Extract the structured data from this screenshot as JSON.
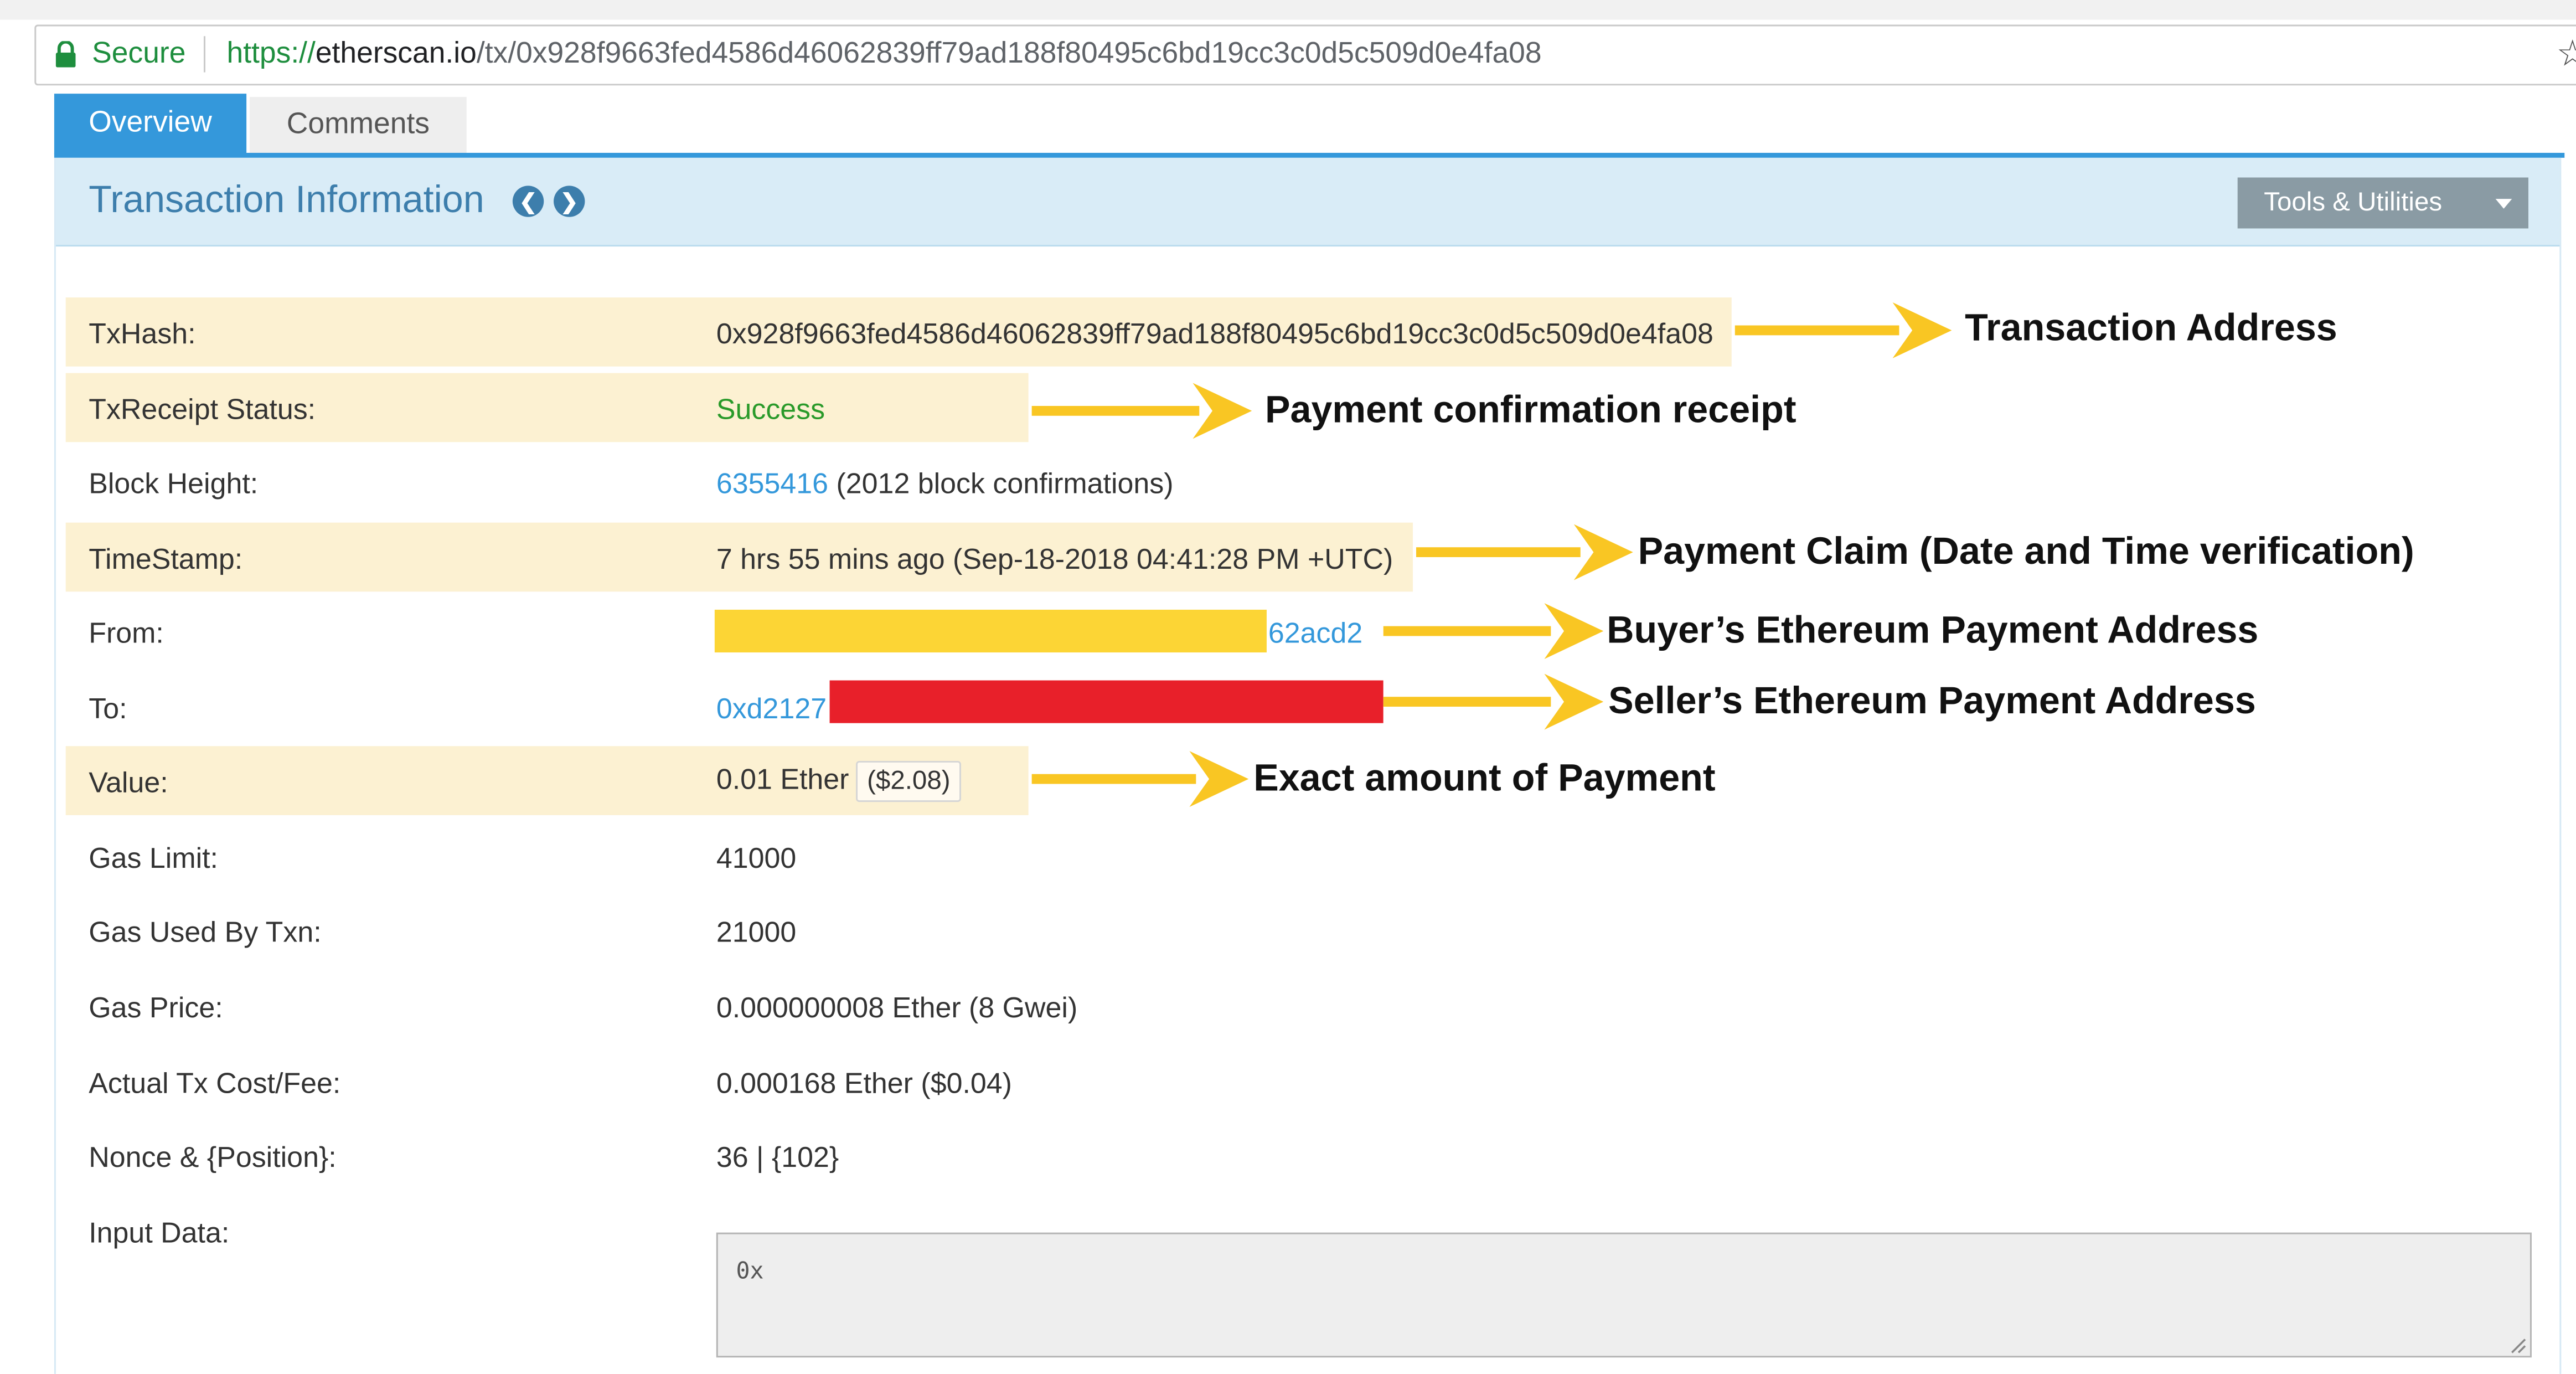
{
  "browser": {
    "secure_label": "Secure",
    "url_scheme": "https://",
    "url_host": "etherscan.io",
    "url_path": "/tx/0x928f9663fed4586d46062839ff79ad188f80495c6bd19cc3c0d5c509d0e4fa08"
  },
  "tabs": [
    {
      "label": "Overview",
      "active": true
    },
    {
      "label": "Comments",
      "active": false
    }
  ],
  "panel": {
    "title": "Transaction Information",
    "tools_label": "Tools & Utilities"
  },
  "rows": {
    "txhash": {
      "label": "TxHash:",
      "value": "0x928f9663fed4586d46062839ff79ad188f80495c6bd19cc3c0d5c509d0e4fa08"
    },
    "status": {
      "label": "TxReceipt Status:",
      "value": "Success"
    },
    "block": {
      "label": "Block Height:",
      "value": "6355416",
      "suffix": "(2012 block confirmations)"
    },
    "timestamp": {
      "label": "TimeStamp:",
      "value": "7 hrs 55 mins ago (Sep-18-2018 04:41:28 PM +UTC)"
    },
    "from": {
      "label": "From:",
      "value_visible": "62acd2"
    },
    "to": {
      "label": "To:",
      "value_visible": "0xd2127"
    },
    "value": {
      "label": "Value:",
      "value": "0.01 Ether",
      "usd": "($2.08)"
    },
    "gas_limit": {
      "label": "Gas Limit:",
      "value": "41000"
    },
    "gas_used": {
      "label": "Gas Used By Txn:",
      "value": "21000"
    },
    "gas_price": {
      "label": "Gas Price:",
      "value": "0.000000008 Ether (8 Gwei)"
    },
    "tx_cost": {
      "label": "Actual Tx Cost/Fee:",
      "value": "0.000168 Ether ($0.04)"
    },
    "nonce": {
      "label": "Nonce & {Position}:",
      "value": "36 | {102}"
    },
    "input": {
      "label": "Input Data:",
      "value": "0x"
    }
  },
  "annotations": {
    "txhash": "Transaction Address",
    "status": "Payment confirmation receipt",
    "timestamp": "Payment Claim (Date and Time verification)",
    "from": "Buyer’s Ethereum Payment Address",
    "to": "Seller’s Ethereum Payment Address",
    "value": "Exact amount of Payment"
  },
  "colors": {
    "accent": "#3498db",
    "highlight": "#fcf1d2",
    "arrow": "#f9c623",
    "redaction_yellow": "#fcd535",
    "redaction_red": "#e8202a",
    "success": "#2a9a2a"
  }
}
